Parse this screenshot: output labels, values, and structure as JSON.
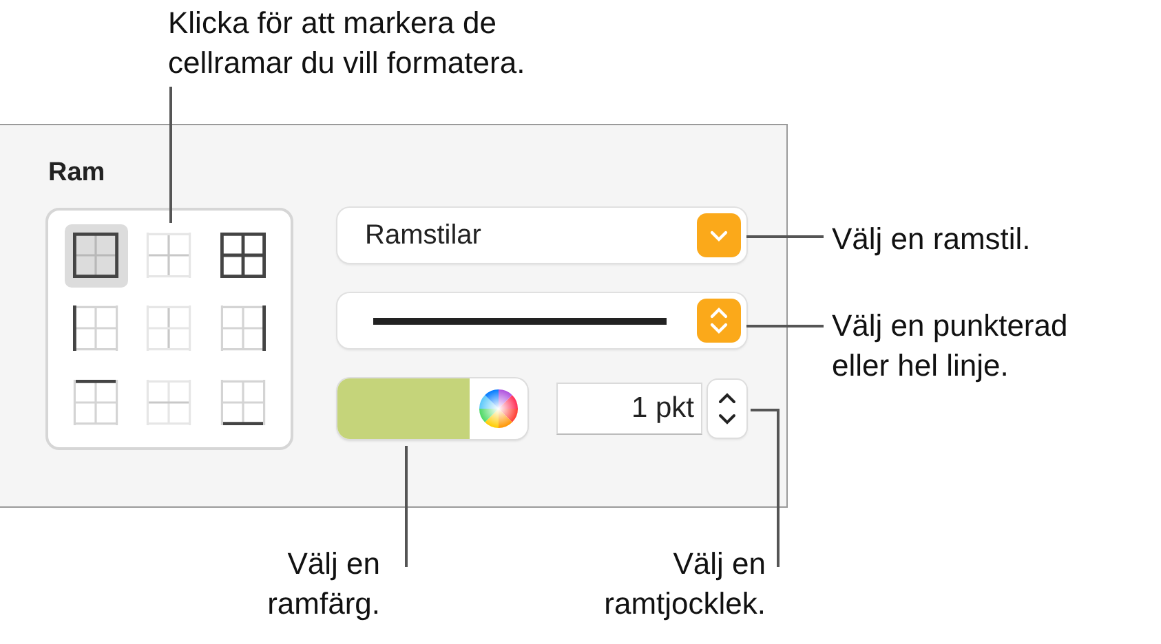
{
  "panel": {
    "title": "Ram",
    "border_grid": [
      {
        "kind": "outer",
        "selected": true
      },
      {
        "kind": "inner",
        "selected": false
      },
      {
        "kind": "all",
        "selected": false
      },
      {
        "kind": "left",
        "selected": false
      },
      {
        "kind": "inner-vertical",
        "selected": false
      },
      {
        "kind": "right",
        "selected": false
      },
      {
        "kind": "top",
        "selected": false
      },
      {
        "kind": "inner-horizontal",
        "selected": false
      },
      {
        "kind": "bottom",
        "selected": false
      }
    ],
    "style_menu": {
      "value": "Ramstilar"
    },
    "color_well": {
      "color": "#c5d47a"
    },
    "thickness": {
      "value": "1 pkt"
    }
  },
  "callouts": [
    {
      "kind": "top",
      "lines": [
        "Klicka för att markera de",
        "cellramar du vill formatera."
      ]
    },
    {
      "kind": "style",
      "lines": [
        "Välj en ramstil."
      ]
    },
    {
      "kind": "line",
      "lines": [
        "Välj en punkterad",
        "eller hel linje."
      ]
    },
    {
      "kind": "color",
      "lines": [
        "Välj en",
        "ramfärg."
      ]
    },
    {
      "kind": "thickness",
      "lines": [
        "Välj en",
        "ramtjocklek."
      ]
    }
  ]
}
